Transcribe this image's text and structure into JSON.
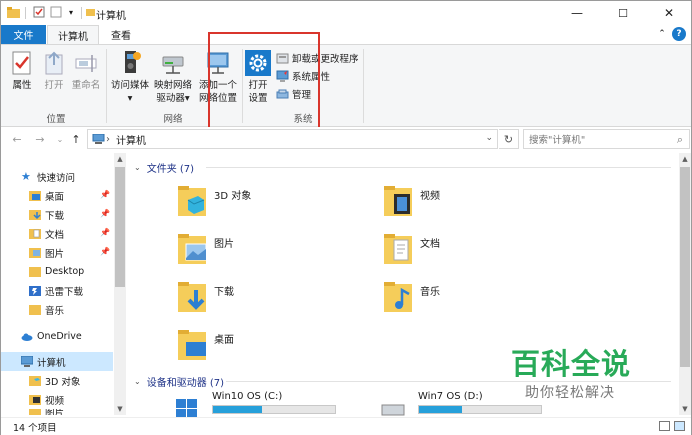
{
  "window": {
    "title": "计算机",
    "minimize_label": "—",
    "maximize_label": "☐",
    "close_label": "✕"
  },
  "quick_access": {
    "properties_icon": "properties-icon",
    "check_icon": "checkmark-icon",
    "folder_icon": "folder-icon",
    "dropdown_label": "▾"
  },
  "ribbon_tabs": [
    {
      "label": "文件"
    },
    {
      "label": "计算机"
    },
    {
      "label": "查看"
    }
  ],
  "ribbon": {
    "location_group": {
      "label": "位置",
      "buttons": [
        {
          "label": "属性"
        },
        {
          "label": "打开"
        },
        {
          "label": "重命名"
        }
      ]
    },
    "network_group": {
      "label": "网络",
      "buttons": [
        {
          "label": "访问媒体",
          "dropdown": "▾"
        },
        {
          "label": "映射网络",
          "label2": "驱动器",
          "dropdown": "▾"
        },
        {
          "label": "添加一个",
          "label2": "网络位置"
        }
      ]
    },
    "system_group": {
      "label": "系统",
      "open_settings": {
        "label": "打开",
        "label2": "设置"
      },
      "items": [
        {
          "label": "卸载或更改程序"
        },
        {
          "label": "系统属性"
        },
        {
          "label": "管理"
        }
      ]
    }
  },
  "address_bar": {
    "path": "计算机",
    "separator": "›",
    "search_placeholder": "搜索\"计算机\""
  },
  "nav_pane": {
    "quick_access": "快速访问",
    "items": [
      {
        "label": "桌面",
        "pinned": true
      },
      {
        "label": "下载",
        "pinned": true
      },
      {
        "label": "文档",
        "pinned": true
      },
      {
        "label": "图片",
        "pinned": true
      },
      {
        "label": "Desktop",
        "pinned": false
      },
      {
        "label": "迅雷下载",
        "pinned": false
      },
      {
        "label": "音乐",
        "pinned": false
      }
    ],
    "onedrive": "OneDrive",
    "this_pc": "计算机",
    "pc_children": [
      {
        "label": "3D 对象"
      },
      {
        "label": "视频"
      },
      {
        "label": "图片"
      }
    ]
  },
  "content": {
    "folders_header": "文件夹 (7)",
    "folders": [
      {
        "label": "3D 对象"
      },
      {
        "label": "视频"
      },
      {
        "label": "图片"
      },
      {
        "label": "文档"
      },
      {
        "label": "下载"
      },
      {
        "label": "音乐"
      },
      {
        "label": "桌面"
      }
    ],
    "devices_header": "设备和驱动器 (7)",
    "drives": [
      {
        "label": "Win10 OS (C:)"
      },
      {
        "label": "Win7 OS (D:)"
      }
    ]
  },
  "status_bar": {
    "count": "14 个项目"
  },
  "watermark": {
    "main": "百科全说",
    "sub": "助你轻松解决"
  },
  "colors": {
    "accent": "#1979ca",
    "selection": "#cce8ff",
    "highlight_box": "#d9352c",
    "watermark_green": "#16a34a"
  }
}
